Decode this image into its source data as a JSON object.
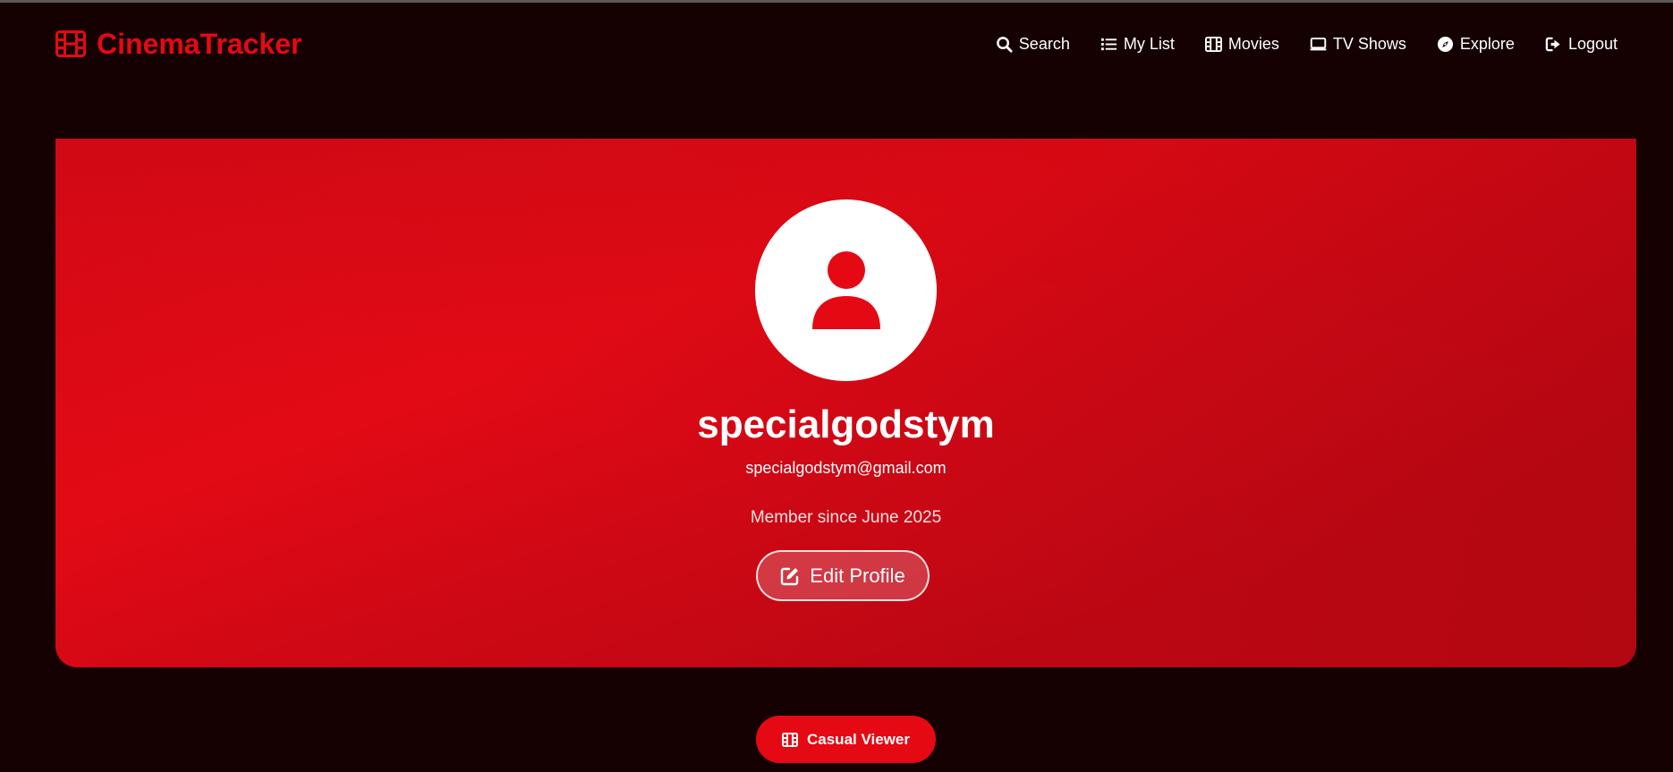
{
  "brand": {
    "name": "CinemaTracker",
    "icon": "film-icon",
    "color": "#e50914"
  },
  "nav": {
    "items": [
      {
        "label": "Search",
        "icon": "search-icon"
      },
      {
        "label": "My List",
        "icon": "list-icon"
      },
      {
        "label": "Movies",
        "icon": "film-icon"
      },
      {
        "label": "TV Shows",
        "icon": "tv-icon"
      },
      {
        "label": "Explore",
        "icon": "compass-icon"
      },
      {
        "label": "Logout",
        "icon": "logout-icon"
      }
    ]
  },
  "profile": {
    "avatar_icon": "user-icon",
    "username": "specialgodstym",
    "email": "specialgodstym@gmail.com",
    "member_since": "Member since June 2025",
    "edit_button_label": "Edit Profile",
    "edit_icon": "edit-icon"
  },
  "badge": {
    "label": "Casual Viewer",
    "icon": "film-icon"
  },
  "colors": {
    "accent": "#e50914",
    "background": "#150002",
    "hero": "#d20915"
  }
}
